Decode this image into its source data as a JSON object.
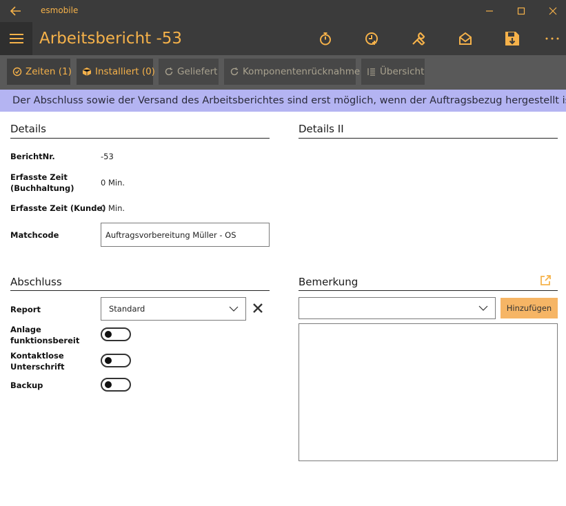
{
  "window": {
    "app_title": "esmobile",
    "minimize_icon": "minimize-icon",
    "maximize_icon": "maximize-icon",
    "close_icon": "close-icon"
  },
  "header": {
    "title": "Arbeitsbericht -53",
    "icons": [
      "stopwatch-icon",
      "clock-add-icon",
      "tools-icon",
      "mail-open-icon",
      "save-download-icon",
      "more-icon"
    ]
  },
  "toolbar": {
    "buttons": [
      {
        "label": "Zeiten (1)",
        "icon": "clock-check-icon",
        "enabled": true
      },
      {
        "label": "Installiert (0)",
        "icon": "box-icon",
        "enabled": true
      },
      {
        "label": "Geliefert",
        "icon": "refresh-icon",
        "enabled": false
      },
      {
        "label": "Komponentenrücknahme",
        "icon": "refresh-icon",
        "enabled": false
      },
      {
        "label": "Übersicht",
        "icon": "list-icon",
        "enabled": false
      }
    ]
  },
  "banner": {
    "text": "Der Abschluss sowie der Versand des Arbeitsberichtes sind erst möglich, wenn der Auftragsbezug hergestellt ist."
  },
  "details": {
    "title": "Details",
    "fields": [
      {
        "label": "BerichtNr.",
        "value": "-53"
      },
      {
        "label": "Erfasste Zeit (Buchhaltung)",
        "value": "0 Min."
      },
      {
        "label": "Erfasste Zeit (Kunde)",
        "value": "0 Min."
      }
    ],
    "matchcode_label": "Matchcode",
    "matchcode_value": "Auftragsvorbereitung Müller - OS"
  },
  "details2": {
    "title": "Details II"
  },
  "abschluss": {
    "title": "Abschluss",
    "report_label": "Report",
    "report_value": "Standard",
    "toggles": [
      {
        "label": "Anlage funktionsbereit",
        "on": false
      },
      {
        "label": "Kontaktlose Unterschrift",
        "on": false
      },
      {
        "label": "Backup",
        "on": false
      }
    ]
  },
  "bemerkung": {
    "title": "Bemerkung",
    "select_value": "",
    "add_button": "Hinzufügen"
  },
  "colors": {
    "accent": "#f6b24a",
    "titlebar_bg": "#3b3b3b",
    "toolbar_bg": "#595959",
    "banner_bg": "#b4b4f2",
    "add_button_bg": "#f6b565"
  }
}
